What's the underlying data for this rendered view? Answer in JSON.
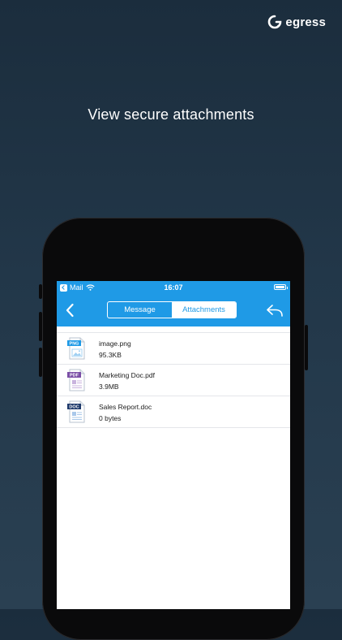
{
  "brand": {
    "name": "egress"
  },
  "headline": "View secure attachments",
  "status_bar": {
    "carrier": "Mail",
    "time": "16:07"
  },
  "nav": {
    "tabs": [
      {
        "label": "Message",
        "selected": false
      },
      {
        "label": "Attachments",
        "selected": true
      }
    ]
  },
  "attachments": [
    {
      "badge": "PNG",
      "name": "image.png",
      "size": "95.3KB",
      "badge_color": "#1f9ae6",
      "icon": "png-file-icon"
    },
    {
      "badge": "PDF",
      "name": "Marketing Doc.pdf",
      "size": "3.9MB",
      "badge_color": "#7b4fa6",
      "icon": "pdf-file-icon"
    },
    {
      "badge": "DOC",
      "name": "Sales Report.doc",
      "size": "0 bytes",
      "badge_color": "#1f3a6b",
      "icon": "doc-file-icon"
    }
  ],
  "colors": {
    "accent": "#1f9ae6",
    "background": "#1b2d3d"
  }
}
